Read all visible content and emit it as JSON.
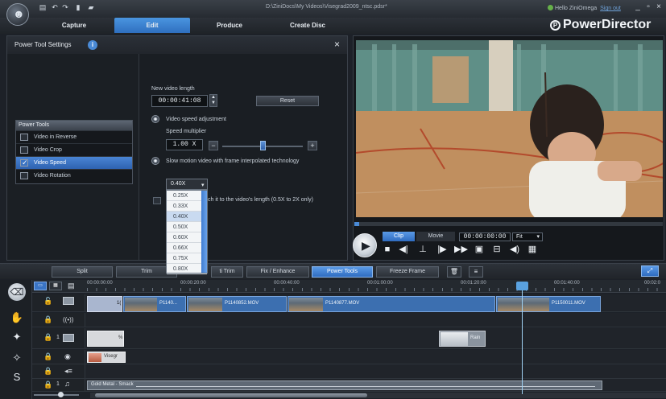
{
  "titlebar": {
    "file_path": "D:\\ZiniDocs\\My Videos\\Visegrad2009_ntsc.pdsr*",
    "hello": "Hello ZiniOmega",
    "sign_out": "Sign out"
  },
  "tabs": [
    "Capture",
    "Edit",
    "Produce",
    "Create Disc"
  ],
  "brand": "PowerDirector",
  "power_tool": {
    "title": "Power Tool Settings",
    "tools_header": "Power Tools",
    "tools": [
      {
        "label": "Video in Reverse",
        "checked": false
      },
      {
        "label": "Video Crop",
        "checked": false
      },
      {
        "label": "Video Speed",
        "checked": true
      },
      {
        "label": "Video Rotation",
        "checked": false
      }
    ],
    "new_length_label": "New video length",
    "new_length_value": "00:00:41:08",
    "reset_label": "Reset",
    "speed_adjust_label": "Video speed adjustment",
    "speed_multiplier_label": "Speed multiplier",
    "speed_multiplier_value": "1.00 X",
    "slow_motion_label": "Slow motion video with frame interpolated technology",
    "stretch_label": "ch it to the video's length (0.5X to 2X only)",
    "dropdown_value": "0.40X",
    "dropdown_options": [
      "0.25X",
      "0.33X",
      "0.40X",
      "0.50X",
      "0.60X",
      "0.66X",
      "0.75X",
      "0.80X"
    ]
  },
  "preview": {
    "clip_tab": "Clip",
    "movie_tab": "Movie",
    "timecode": "00:00:00:00",
    "fit": "Fit"
  },
  "toolbar": {
    "split": "Split",
    "trim": "Trim",
    "multi_trim": "ti Trim",
    "fix_enhance": "Fix / Enhance",
    "power_tools": "Power Tools",
    "freeze_frame": "Freeze Frame"
  },
  "ruler": [
    "00:00:00:00",
    "00:00:20:00",
    "00:00:40:00",
    "00:01:00:00",
    "00:01:20:00",
    "00:01:40:00",
    "00:02:0"
  ],
  "clips": {
    "v1": [
      "1(",
      "P1140... ",
      "P1140852.MOV",
      "P1140877.MOV",
      "P1150011.MOV"
    ],
    "rain": "Rain",
    "fx_label": "%",
    "title_clip": "Visegr",
    "music": "Gold Metal - Smack"
  },
  "track_numbers": [
    "1",
    "1"
  ]
}
